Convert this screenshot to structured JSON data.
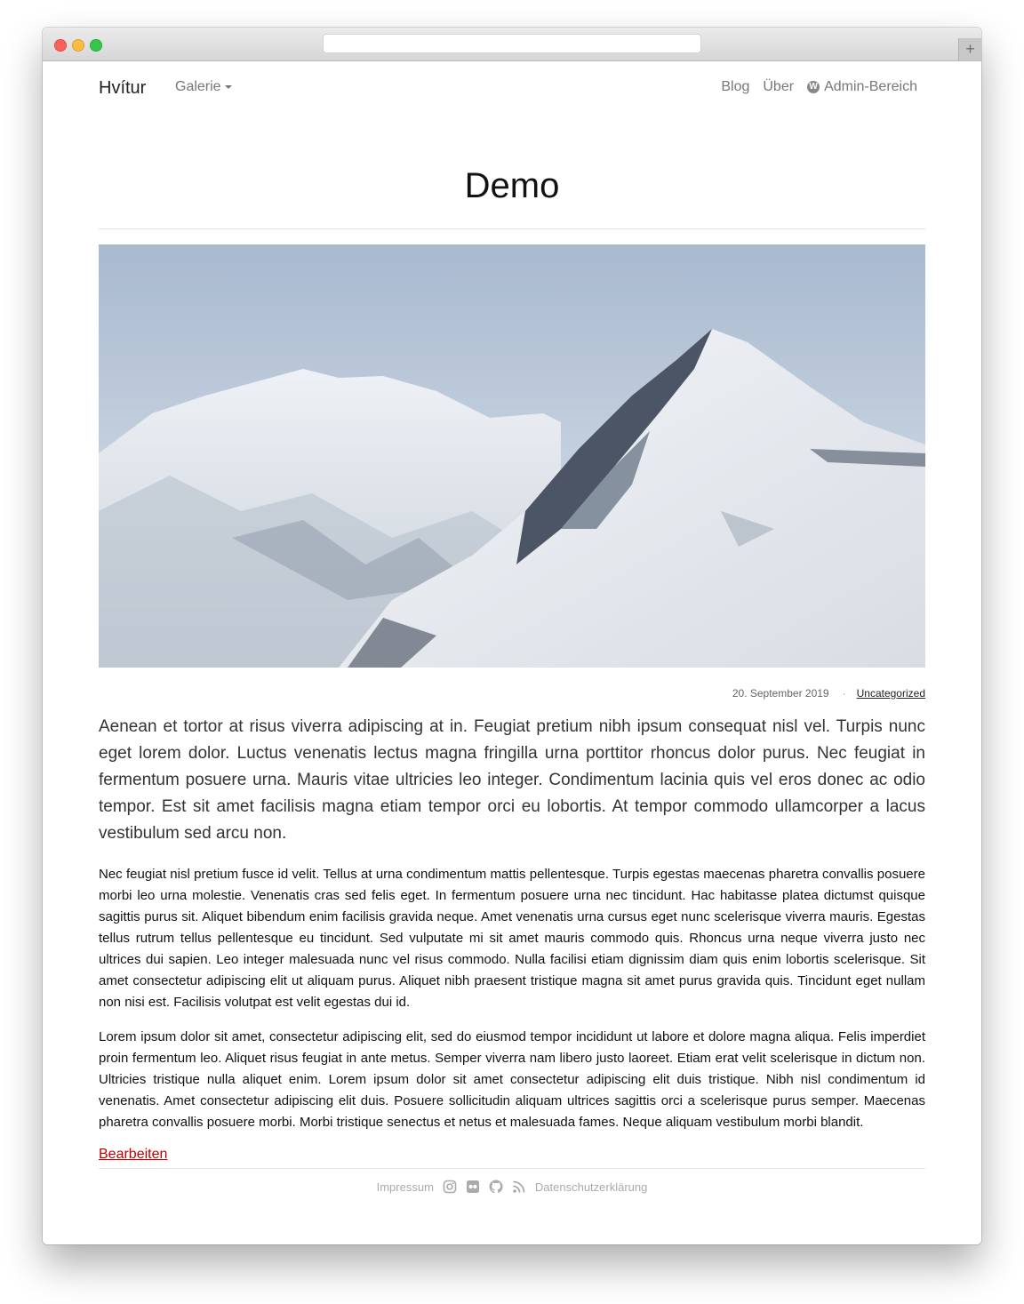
{
  "browser": {
    "new_tab_label": "+"
  },
  "nav": {
    "brand": "Hvítur",
    "gallery_label": "Galerie",
    "links": {
      "blog": "Blog",
      "about": "Über",
      "admin": "Admin-Bereich"
    },
    "admin_icon": "wordpress-icon"
  },
  "post": {
    "title": "Demo",
    "hero_image": "snowy-mountain-peaks",
    "date": "20. September 2019",
    "category": "Uncategorized",
    "lead": "Aenean et tortor at risus viverra adipiscing at in. Feugiat pretium nibh ipsum consequat nisl vel. Turpis nunc eget lorem dolor. Luctus venenatis lectus magna fringilla urna porttitor rhoncus dolor purus. Nec feugiat in fermentum posuere urna. Mauris vitae ultricies leo integer. Condimentum lacinia quis vel eros donec ac odio tempor. Est sit amet facilisis magna etiam tempor orci eu lobortis. At tempor commodo ullamcorper a lacus vestibulum sed arcu non.",
    "paragraphs": [
      "Nec feugiat nisl pretium fusce id velit. Tellus at urna condimentum mattis pellentesque. Turpis egestas maecenas pharetra convallis posuere morbi leo urna molestie. Venenatis cras sed felis eget. In fermentum posuere urna nec tincidunt. Hac habitasse platea dictumst quisque sagittis purus sit. Aliquet bibendum enim facilisis gravida neque. Amet venenatis urna cursus eget nunc scelerisque viverra mauris. Egestas tellus rutrum tellus pellentesque eu tincidunt. Sed vulputate mi sit amet mauris commodo quis. Rhoncus urna neque viverra justo nec ultrices dui sapien. Leo integer malesuada nunc vel risus commodo. Nulla facilisi etiam dignissim diam quis enim lobortis scelerisque. Sit amet consectetur adipiscing elit ut aliquam purus. Aliquet nibh praesent tristique magna sit amet purus gravida quis. Tincidunt eget nullam non nisi est. Facilisis volutpat est velit egestas dui id.",
      "Lorem ipsum dolor sit amet, consectetur adipiscing elit, sed do eiusmod tempor incididunt ut labore et dolore magna aliqua. Felis imperdiet proin fermentum leo. Aliquet risus feugiat in ante metus. Semper viverra nam libero justo laoreet. Etiam erat velit scelerisque in dictum non. Ultricies tristique nulla aliquet enim. Lorem ipsum dolor sit amet consectetur adipiscing elit duis tristique. Nibh nisl condimentum id venenatis. Amet consectetur adipiscing elit duis. Posuere sollicitudin aliquam ultrices sagittis orci a scelerisque purus semper. Maecenas pharetra convallis posuere morbi. Morbi tristique senectus et netus et malesuada fames. Neque aliquam vestibulum morbi blandit."
    ],
    "edit_label": "Bearbeiten"
  },
  "footer": {
    "impressum": "Impressum",
    "privacy": "Datenschutzerklärung",
    "icons": [
      "instagram-icon",
      "flickr-icon",
      "github-icon",
      "rss-icon"
    ]
  },
  "colors": {
    "link_accent": "#c00000",
    "muted_text": "#777777",
    "footer_text": "#aaaaaa"
  }
}
